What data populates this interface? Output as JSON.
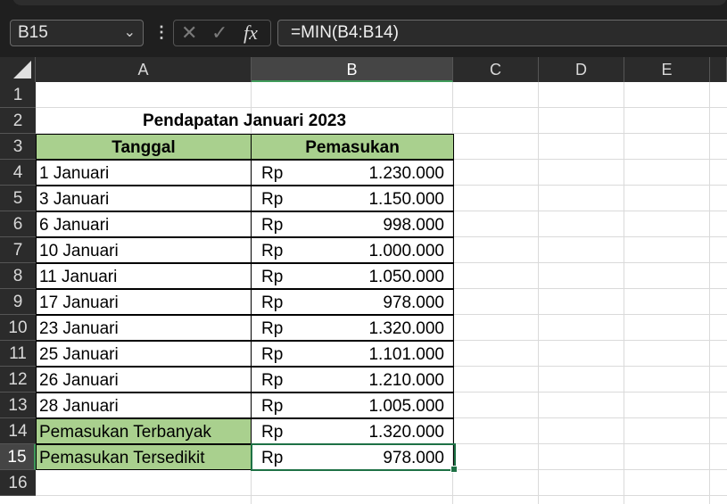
{
  "formula_bar": {
    "name_box": "B15",
    "formula": "=MIN(B4:B14)",
    "fx_label": "fx"
  },
  "columns": [
    "A",
    "B",
    "C",
    "D",
    "E"
  ],
  "rows": [
    "1",
    "2",
    "3",
    "4",
    "5",
    "6",
    "7",
    "8",
    "9",
    "10",
    "11",
    "12",
    "13",
    "14",
    "15",
    "16"
  ],
  "sheet": {
    "title": "Pendapatan Januari 2023",
    "headers": {
      "a": "Tanggal",
      "b": "Pemasukan"
    },
    "currency": "Rp",
    "data": [
      {
        "date": "1 Januari",
        "amount": "1.230.000"
      },
      {
        "date": "3 Januari",
        "amount": "1.150.000"
      },
      {
        "date": "6 Januari",
        "amount": "998.000"
      },
      {
        "date": "10 Januari",
        "amount": "1.000.000"
      },
      {
        "date": "11 Januari",
        "amount": "1.050.000"
      },
      {
        "date": "17 Januari",
        "amount": "978.000"
      },
      {
        "date": "23 Januari",
        "amount": "1.320.000"
      },
      {
        "date": "25 Januari",
        "amount": "1.101.000"
      },
      {
        "date": "26 Januari",
        "amount": "1.210.000"
      },
      {
        "date": "28 Januari",
        "amount": "1.005.000"
      }
    ],
    "summary": [
      {
        "label": "Pemasukan Terbanyak",
        "amount": "1.320.000"
      },
      {
        "label": "Pemasukan Tersedikit",
        "amount": "978.000"
      }
    ]
  },
  "colors": {
    "header_fill": "#a9d08e",
    "selection": "#1e7145"
  }
}
